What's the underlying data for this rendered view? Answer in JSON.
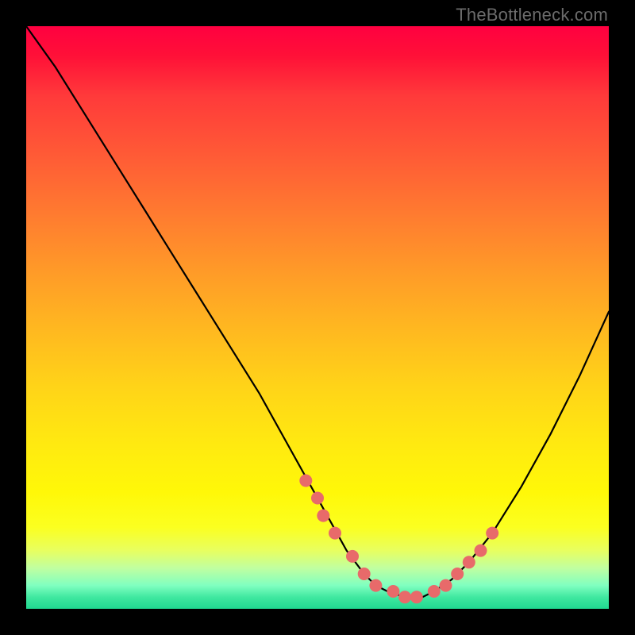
{
  "watermark": "TheBottleneck.com",
  "colors": {
    "background": "#000000",
    "curve_stroke": "#000000",
    "marker_fill": "#e86a6a",
    "marker_stroke": "#c94f4f",
    "watermark": "#6b6b6b"
  },
  "chart_data": {
    "type": "line",
    "title": "",
    "xlabel": "",
    "ylabel": "",
    "xlim": [
      0,
      100
    ],
    "ylim": [
      0,
      100
    ],
    "grid": false,
    "legend": false,
    "annotations": [],
    "series": [
      {
        "name": "curve",
        "x": [
          0,
          5,
          10,
          15,
          20,
          25,
          30,
          35,
          40,
          45,
          50,
          55,
          58,
          60,
          62,
          65,
          68,
          70,
          73,
          76,
          80,
          85,
          90,
          95,
          100
        ],
        "y": [
          100,
          93,
          85,
          77,
          69,
          61,
          53,
          45,
          37,
          28,
          19,
          10,
          6,
          4,
          3,
          2,
          2,
          3,
          5,
          8,
          13,
          21,
          30,
          40,
          51
        ]
      }
    ],
    "markers": {
      "name": "highlighted-points",
      "x": [
        48,
        50,
        51,
        53,
        56,
        58,
        60,
        63,
        65,
        67,
        70,
        72,
        74,
        76,
        78,
        80
      ],
      "y": [
        22,
        19,
        16,
        13,
        9,
        6,
        4,
        3,
        2,
        2,
        3,
        4,
        6,
        8,
        10,
        13
      ]
    }
  }
}
